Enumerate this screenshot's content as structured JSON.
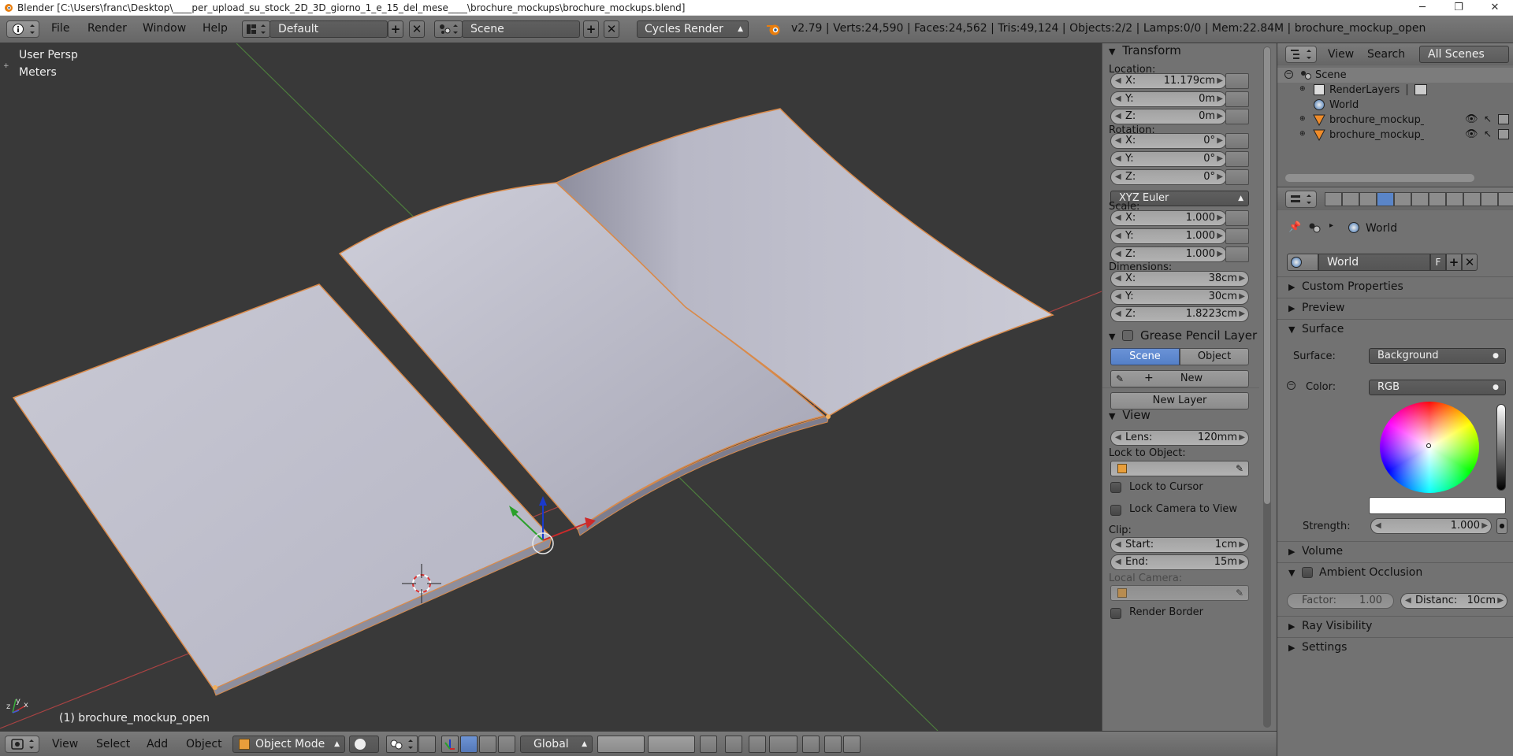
{
  "titlebar": {
    "title": "Blender [C:\\Users\\franc\\Desktop\\____per_upload_su_stock_2D_3D_giorno_1_e_15_del_mese____\\brochure_mockups\\brochure_mockups.blend]"
  },
  "info": {
    "menus": [
      "File",
      "Render",
      "Window",
      "Help"
    ],
    "screen_layout": "Default",
    "scene": "Scene",
    "engine": "Cycles Render",
    "stats": "v2.79 | Verts:24,590 | Faces:24,562 | Tris:49,124 | Objects:2/2 | Lamps:0/0 | Mem:22.84M | brochure_mockup_open"
  },
  "viewport": {
    "view_name": "User Persp",
    "units": "Meters",
    "active_object": "(1) brochure_mockup_open"
  },
  "footer": {
    "menus": [
      "View",
      "Select",
      "Add",
      "Object"
    ],
    "mode": "Object Mode",
    "orientation": "Global"
  },
  "npanel": {
    "transform": {
      "title": "Transform",
      "location_label": "Location:",
      "location": [
        {
          "axis": "X:",
          "value": "11.179cm"
        },
        {
          "axis": "Y:",
          "value": "0m"
        },
        {
          "axis": "Z:",
          "value": "0m"
        }
      ],
      "rotation_label": "Rotation:",
      "rotation": [
        {
          "axis": "X:",
          "value": "0°"
        },
        {
          "axis": "Y:",
          "value": "0°"
        },
        {
          "axis": "Z:",
          "value": "0°"
        }
      ],
      "rotation_mode": "XYZ Euler",
      "scale_label": "Scale:",
      "scale": [
        {
          "axis": "X:",
          "value": "1.000"
        },
        {
          "axis": "Y:",
          "value": "1.000"
        },
        {
          "axis": "Z:",
          "value": "1.000"
        }
      ],
      "dimensions_label": "Dimensions:",
      "dimensions": [
        {
          "axis": "X:",
          "value": "38cm"
        },
        {
          "axis": "Y:",
          "value": "30cm"
        },
        {
          "axis": "Z:",
          "value": "1.8223cm"
        }
      ]
    },
    "grease": {
      "title": "Grease Pencil Layer",
      "tab_scene": "Scene",
      "tab_object": "Object",
      "new": "New",
      "new_layer": "New Layer"
    },
    "view": {
      "title": "View",
      "lens_label": "Lens:",
      "lens_value": "120mm",
      "lock_to_object": "Lock to Object:",
      "lock_cursor": "Lock to Cursor",
      "lock_camera": "Lock Camera to View",
      "clip_label": "Clip:",
      "clip_start_label": "Start:",
      "clip_start": "1cm",
      "clip_end_label": "End:",
      "clip_end": "15m",
      "local_camera": "Local Camera:",
      "render_border": "Render Border"
    }
  },
  "outliner": {
    "menus": [
      "View",
      "Search"
    ],
    "filter": "All Scenes",
    "items": [
      {
        "label": "Scene"
      },
      {
        "label": "RenderLayers"
      },
      {
        "label": "World"
      },
      {
        "label": "brochure_mockup_closed"
      },
      {
        "label": "brochure_mockup_open"
      }
    ]
  },
  "properties": {
    "breadcrumb": "World",
    "world_name": "World",
    "fake_user": "F",
    "sections": {
      "custom_properties": "Custom Properties",
      "preview": "Preview",
      "surface": "Surface",
      "volume": "Volume",
      "ambient_occlusion": "Ambient Occlusion",
      "ray_visibility": "Ray Visibility",
      "settings": "Settings"
    },
    "surface_label": "Surface:",
    "surface_value": "Background",
    "color_label": "Color:",
    "color_mode": "RGB",
    "strength_label": "Strength:",
    "strength_value": "1.000",
    "factor_label": "Factor:",
    "factor_value": "1.00",
    "distance_label": "Distanc:",
    "distance_value": "10cm"
  }
}
